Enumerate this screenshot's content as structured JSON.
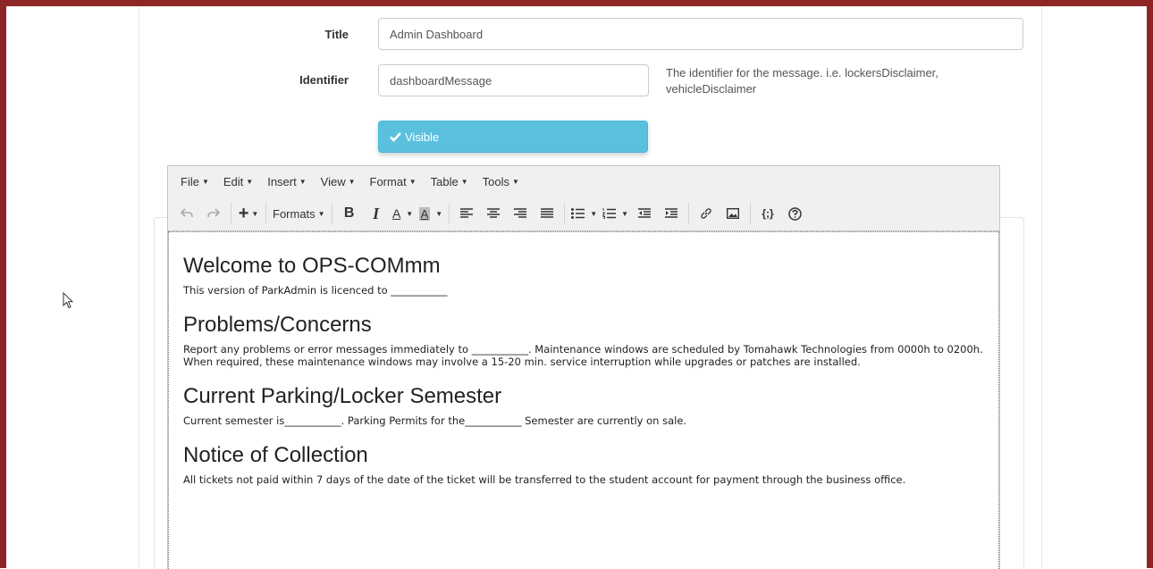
{
  "form": {
    "title_label": "Title",
    "title_value": "Admin Dashboard",
    "identifier_label": "Identifier",
    "identifier_value": "dashboardMessage",
    "identifier_help": "The identifier for the message. i.e. lockersDisclaimer, vehicleDisclaimer",
    "visible_label": "Visible"
  },
  "menubar": [
    "File",
    "Edit",
    "Insert",
    "View",
    "Format",
    "Table",
    "Tools"
  ],
  "toolbar": {
    "formats_label": "Formats",
    "bold": "B",
    "italic": "I",
    "font_color": "A",
    "bg_color": "A",
    "code": "{;}"
  },
  "content": {
    "h1": "Welcome to OPS-COMmm",
    "p1": "This version of ParkAdmin is licenced to ___________",
    "h2": "Problems/Concerns",
    "p2": "Report any problems or error messages immediately to ___________. Maintenance windows are scheduled by Tomahawk Technologies from 0000h to 0200h. When required, these maintenance windows may involve a 15-20 min. service interruption while upgrades or patches are installed.",
    "h3": "Current Parking/Locker Semester",
    "p3": "Current semester is___________. Parking Permits for the___________ Semester are currently on sale.",
    "h4": "Notice of Collection",
    "p4": "All tickets not paid within 7 days of the date of the ticket will be transferred to the student account for payment through the business office."
  },
  "colors": {
    "frame": "#8f2626",
    "visible_button": "#5bc0de"
  }
}
